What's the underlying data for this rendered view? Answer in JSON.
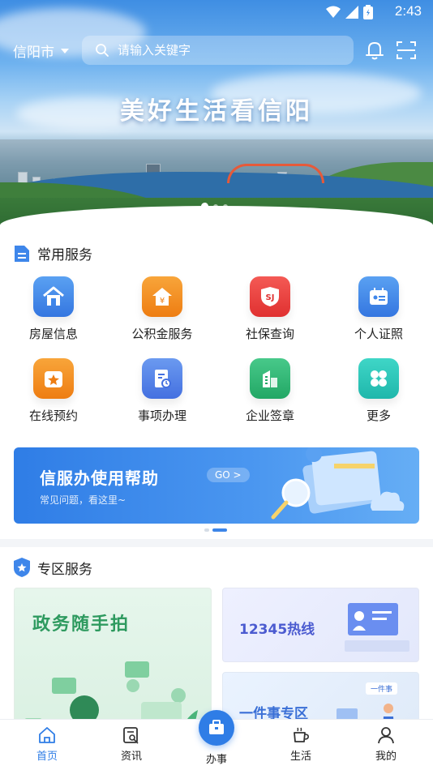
{
  "status": {
    "time": "2:43"
  },
  "header": {
    "city": "信阳市",
    "search_placeholder": "请输入关键字"
  },
  "hero": {
    "title": "美好生活看信阳"
  },
  "common_services": {
    "title": "常用服务",
    "items": [
      {
        "label": "房屋信息",
        "icon": "house-icon",
        "color": "#3e86ea"
      },
      {
        "label": "公积金服务",
        "icon": "housing-fund-icon",
        "color": "#f08a1d"
      },
      {
        "label": "社保查询",
        "icon": "social-security-icon",
        "color": "#ea3c3c"
      },
      {
        "label": "个人证照",
        "icon": "id-card-icon",
        "color": "#3e86ea"
      },
      {
        "label": "在线预约",
        "icon": "star-calendar-icon",
        "color": "#f08a1d"
      },
      {
        "label": "事项办理",
        "icon": "document-clock-icon",
        "color": "#4a7fe5"
      },
      {
        "label": "企业签章",
        "icon": "building-icon",
        "color": "#2fb36d"
      },
      {
        "label": "更多",
        "icon": "grid-more-icon",
        "color": "#27c3b8"
      }
    ]
  },
  "help_banner": {
    "title": "信服办使用帮助",
    "go": "GO >",
    "subtitle": "常见问题，看这里~"
  },
  "zone_services": {
    "title": "专区服务",
    "cards": [
      {
        "title": "政务随手拍"
      },
      {
        "title": "12345热线"
      },
      {
        "title": "一件事专区",
        "tag": "一件事"
      }
    ]
  },
  "bottom_nav": [
    {
      "label": "首页",
      "icon": "home-icon",
      "active": true
    },
    {
      "label": "资讯",
      "icon": "news-icon",
      "active": false
    },
    {
      "label": "办事",
      "icon": "briefcase-icon",
      "active": false
    },
    {
      "label": "生活",
      "icon": "coffee-cup-icon",
      "active": false
    },
    {
      "label": "我的",
      "icon": "user-icon",
      "active": false
    }
  ],
  "colors": {
    "primary": "#2f7de6",
    "zone_green": "#2e9a5f",
    "zone_purple": "#4b5bd0"
  }
}
